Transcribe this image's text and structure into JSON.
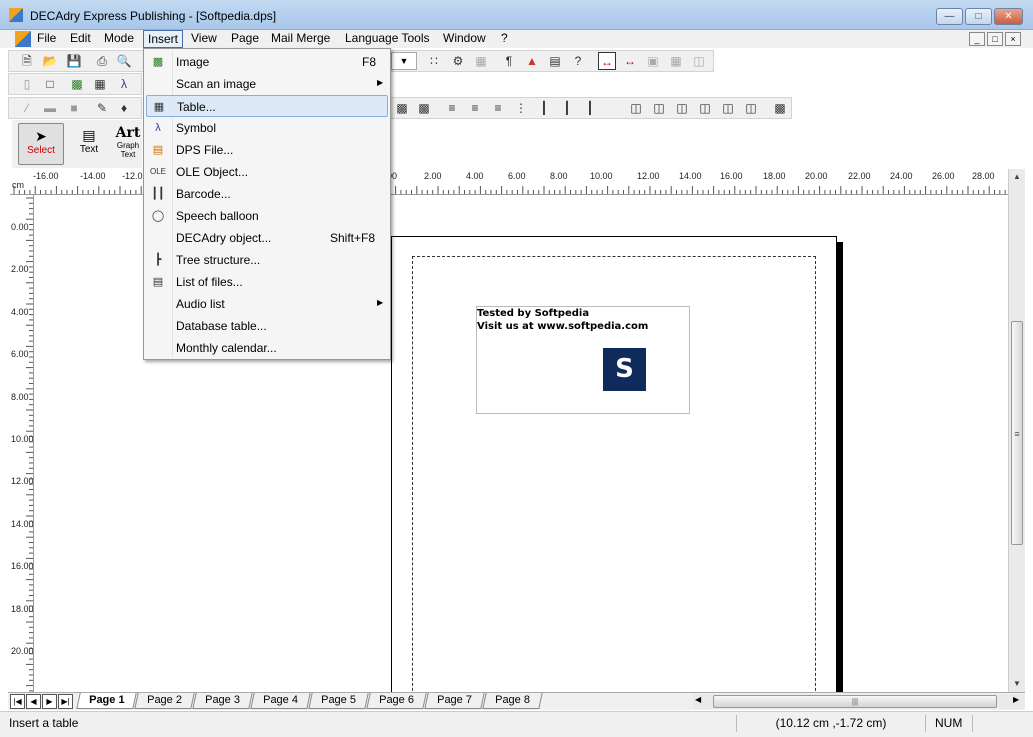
{
  "window": {
    "title": "DECAdry Express Publishing - [Softpedia.dps]"
  },
  "menubar": [
    "File",
    "Edit",
    "Mode",
    "Insert",
    "View",
    "Page",
    "Mail Merge",
    "Language Tools",
    "Window",
    "?"
  ],
  "insert_menu": [
    {
      "label": "Image",
      "shortcut": "F8",
      "icon": "image-icon",
      "submenu": false
    },
    {
      "label": "Scan an image",
      "shortcut": "",
      "icon": "scan-icon",
      "submenu": true
    },
    {
      "label": "Table...",
      "shortcut": "",
      "icon": "table-icon",
      "submenu": false,
      "highlighted": true
    },
    {
      "label": "Symbol",
      "shortcut": "",
      "icon": "lambda-icon",
      "submenu": false
    },
    {
      "label": "DPS File...",
      "shortcut": "",
      "icon": "dps-icon",
      "submenu": false
    },
    {
      "label": "OLE Object...",
      "shortcut": "",
      "icon": "ole-icon",
      "submenu": false
    },
    {
      "label": "Barcode...",
      "shortcut": "",
      "icon": "barcode-icon",
      "submenu": false
    },
    {
      "label": "Speech balloon",
      "shortcut": "",
      "icon": "balloon-icon",
      "submenu": false
    },
    {
      "label": "DECAdry object...",
      "shortcut": "Shift+F8",
      "icon": "",
      "submenu": false
    },
    {
      "label": "Tree structure...",
      "shortcut": "",
      "icon": "tree-icon",
      "submenu": false
    },
    {
      "label": "List of files...",
      "shortcut": "",
      "icon": "list-icon",
      "submenu": false
    },
    {
      "label": "Audio list",
      "shortcut": "",
      "icon": "",
      "submenu": true
    },
    {
      "label": "Database table...",
      "shortcut": "",
      "icon": "",
      "submenu": false
    },
    {
      "label": "Monthly calendar...",
      "shortcut": "",
      "icon": "",
      "submenu": false
    }
  ],
  "palette": {
    "select": "Select",
    "text": "Text",
    "art_title": "Art",
    "art_sub1": "Graph",
    "art_sub2": "Text"
  },
  "ruler": {
    "unit": "cm",
    "h_ticks": [
      "-16.00",
      "-14.00",
      "-12.0",
      "00",
      "2.00",
      "4.00",
      "6.00",
      "8.00",
      "10.00",
      "12.00",
      "14.00",
      "16.00",
      "18.00",
      "20.00",
      "22.00",
      "24.00",
      "26.00",
      "28.00"
    ],
    "v_ticks": [
      "0.00",
      "2.00",
      "4.00",
      "6.00",
      "8.00",
      "10.00",
      "12.00",
      "14.00",
      "16.00",
      "18.00",
      "20.00"
    ]
  },
  "document": {
    "line1": "Tested by Softpedia",
    "line2": "Visit us at www.softpedia.com",
    "logo_letter": "S"
  },
  "page_tabs": [
    "Page 1",
    "Page 2",
    "Page 3",
    "Page 4",
    "Page 5",
    "Page 6",
    "Page 7",
    "Page 8"
  ],
  "status": {
    "hint": "Insert a table",
    "coords": "(10.12 cm ,-1.72 cm)",
    "num": "NUM"
  }
}
